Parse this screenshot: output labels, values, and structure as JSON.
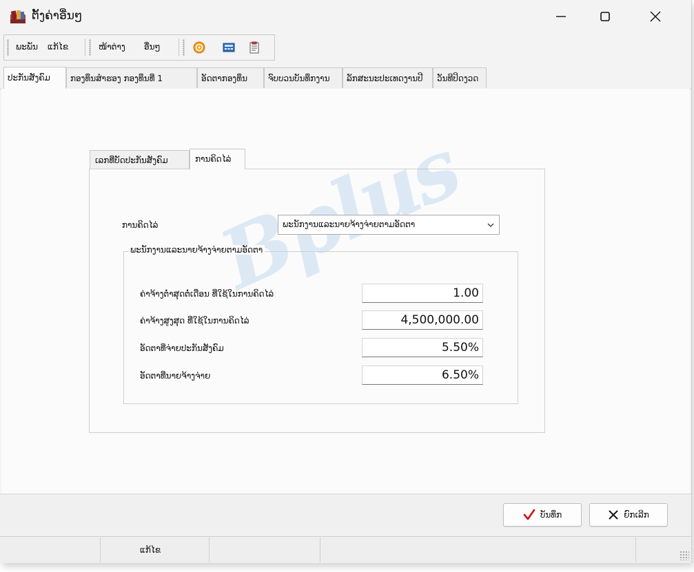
{
  "window": {
    "title": "ຕັ້ງຄ່າອື່ນໆ",
    "icon": "app-books-icon",
    "controls": [
      "minimize-icon",
      "maximize-icon",
      "close-icon"
    ]
  },
  "toolbar": {
    "items": [
      {
        "label": "ພະພັນ"
      },
      {
        "label": "ແກ້ໄຂ"
      },
      {
        "label": "ໜ້າຕ່າງ"
      },
      {
        "label": "ອື່ນໆ"
      }
    ],
    "icons": [
      "help-circle-icon",
      "calculator-icon",
      "document-icon"
    ]
  },
  "tabs": [
    {
      "label": "ປະກັນສັງຄົມ",
      "active": true
    },
    {
      "label": "ກອງທຶນສຳຮອງ ກອງທຶນທີ່ 1",
      "active": false
    },
    {
      "label": "ອັດຕາກອງທຶນ",
      "active": false
    },
    {
      "label": "ຈົບບວນບັນທຶກງານ",
      "active": false
    },
    {
      "label": "ລັກສະນະປະເທດງານປີ",
      "active": false
    },
    {
      "label": "ວັນທີປິດງວດ",
      "active": false
    }
  ],
  "inner_tabs": [
    {
      "label": "ເລກທີ່ບັດປະກັນສັງຄົມ",
      "active": false
    },
    {
      "label": "ການຄິດໄລ່",
      "active": true
    }
  ],
  "calc": {
    "method_label": "ການຄິດໄລ່",
    "method_value": "ພະນັກງານແລະນາຍຈ້າງຈ່າຍຕາມອັດຕາ",
    "group_title": "ພະນັກງານແລະນາຍຈ້າງຈ່າຍຕາມອັດຕາ",
    "rows": [
      {
        "label": "ຄ່າຈ້າງຕໍ່າສຸດຕໍ່ເດືອນ ທີ່ໃຊ້ໃນການຄິດໄລ່",
        "value": "1.00"
      },
      {
        "label": "ຄ່າຈ້າງສູງສຸດ ທີ່ໃຊ້ໃນການຄິດໄລ່",
        "value": "4,500,000.00"
      },
      {
        "label": "ອັດຕາທີ່ຈ່າຍປະກັນສັງຄົມ",
        "value": "5.50%"
      },
      {
        "label": "ອັດຕາທີ່ນາຍຈ້າງຈ່າຍ",
        "value": "6.50%"
      }
    ]
  },
  "watermark": "Bplus",
  "buttons": {
    "save": {
      "label": "ບັນທຶກ",
      "icon": "check-icon"
    },
    "cancel": {
      "label": "ຍົກເລີກ",
      "icon": "x-icon"
    }
  },
  "status": {
    "text": "ແກ້ໄຂ"
  },
  "colors": {
    "check": "#cc1111",
    "watermark": "#6eaae1"
  }
}
